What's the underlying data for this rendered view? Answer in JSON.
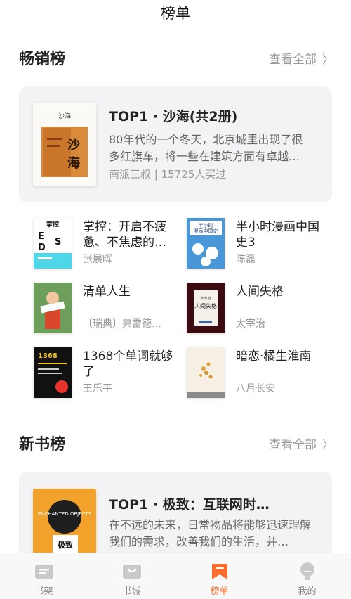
{
  "header": {
    "title": "榜单"
  },
  "bestseller": {
    "section_title": "畅销榜",
    "more_label": "查看全部",
    "top": {
      "title": "TOP1 · 沙海(共2册)",
      "desc": "80年代的一个冬天，北京城里出现了很多红旗车，将一些在建筑方面有卓越…",
      "meta": "南派三叔 |  15725人买过",
      "cover_text": "沙海"
    },
    "books": [
      {
        "title": "掌控：开启不疲惫、不焦虑的…",
        "author": "张展晖",
        "cover_text": "掌控"
      },
      {
        "title": "半小时漫画中国史3",
        "author": "陈磊",
        "cover_text": "半小时漫画中国史3"
      },
      {
        "title": "清单人生",
        "author": "〔瑞典〕弗雷德…",
        "cover_text": "清单人生"
      },
      {
        "title": "人间失格",
        "author": "太宰治",
        "cover_text": "人间失格"
      },
      {
        "title": "1368个单词就够了",
        "author": "王乐平",
        "cover_text": "1368个单词就够了"
      },
      {
        "title": "暗恋·橘生淮南",
        "author": "八月长安",
        "cover_text": ""
      }
    ]
  },
  "newbooks": {
    "section_title": "新书榜",
    "more_label": "查看全部",
    "top": {
      "title": "TOP1 · 极致：互联网时…",
      "desc": "在不远的未来，日常物品将能够迅速理解我们的需求，改善我们的生活，并…",
      "cover_text": "极致",
      "cover_subtext": "ENCHANTED OBJECTS"
    }
  },
  "tabbar": {
    "tabs": [
      {
        "label": "书架",
        "icon": "bookshelf-icon"
      },
      {
        "label": "书城",
        "icon": "bookstore-icon"
      },
      {
        "label": "榜单",
        "icon": "ranking-icon",
        "active": true
      },
      {
        "label": "我的",
        "icon": "profile-icon"
      }
    ]
  },
  "colors": {
    "accent": "#ff6b2c",
    "card_bg": "#f3f3f5"
  }
}
